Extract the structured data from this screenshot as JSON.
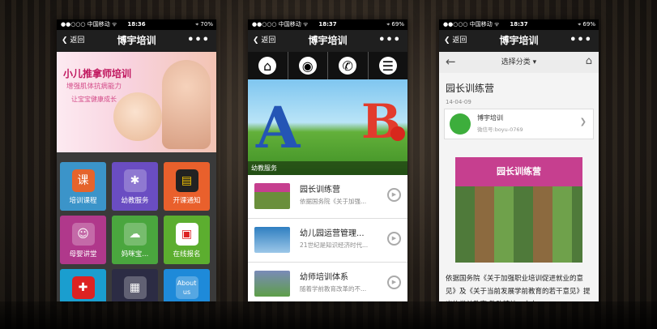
{
  "phones": [
    {
      "status": {
        "carrier": "●●○○○ 中国移动 ᯤ",
        "time": "18:36",
        "battery": "⌖ 70%"
      },
      "nav": {
        "back": "返回",
        "title": "博宇培训",
        "more": "•••"
      },
      "banner": {
        "line1": "小儿推拿师培训",
        "line2": "增强肌体抗病能力",
        "line3": "让宝宝健康成长"
      },
      "tiles": [
        {
          "label": "培训课程",
          "icon": "book-icon"
        },
        {
          "label": "幼教服务",
          "icon": "puzzle-icon"
        },
        {
          "label": "开课通知",
          "icon": "message-icon"
        },
        {
          "label": "母婴讲堂",
          "icon": "baby-icon"
        },
        {
          "label": "妈咪宝...",
          "icon": "chat-icon"
        },
        {
          "label": "在线报名",
          "icon": "calendar-icon"
        },
        {
          "label": "",
          "icon": "plus-icon"
        },
        {
          "label": "",
          "icon": "grid-icon"
        },
        {
          "label": "About us",
          "icon": "info-icon"
        }
      ]
    },
    {
      "status": {
        "carrier": "●●○○○ 中国移动 ᯤ",
        "time": "18:37",
        "battery": "⌖ 69%"
      },
      "nav": {
        "back": "返回",
        "title": "博宇培训",
        "more": "•••"
      },
      "banner_caption": "幼教服务",
      "items": [
        {
          "title": "园长训练营",
          "desc": "依据国务院《关于加强..."
        },
        {
          "title": "幼儿园运营管理...",
          "desc": "21世纪是知识经济时代..."
        },
        {
          "title": "幼师培训体系",
          "desc": "随着学前教育改革的不..."
        }
      ]
    },
    {
      "status": {
        "carrier": "●●○○○ 中国移动 ᯤ",
        "time": "18:37",
        "battery": "⌖ 69%"
      },
      "nav": {
        "back": "返回",
        "title": "博宇培训",
        "more": "•••"
      },
      "category": "选择分类 ▾",
      "article": {
        "title": "园长训练营",
        "date": "14-04-09",
        "author": "博宇培训",
        "author_id": "微信号:boyu-0769",
        "image_header": "园长训练营",
        "body": "依据国务院《关于加强职业培训促进就业的意见》及《关于当前发展学前教育的若干意见》提出的学前教育 教改精神，大力"
      }
    }
  ]
}
